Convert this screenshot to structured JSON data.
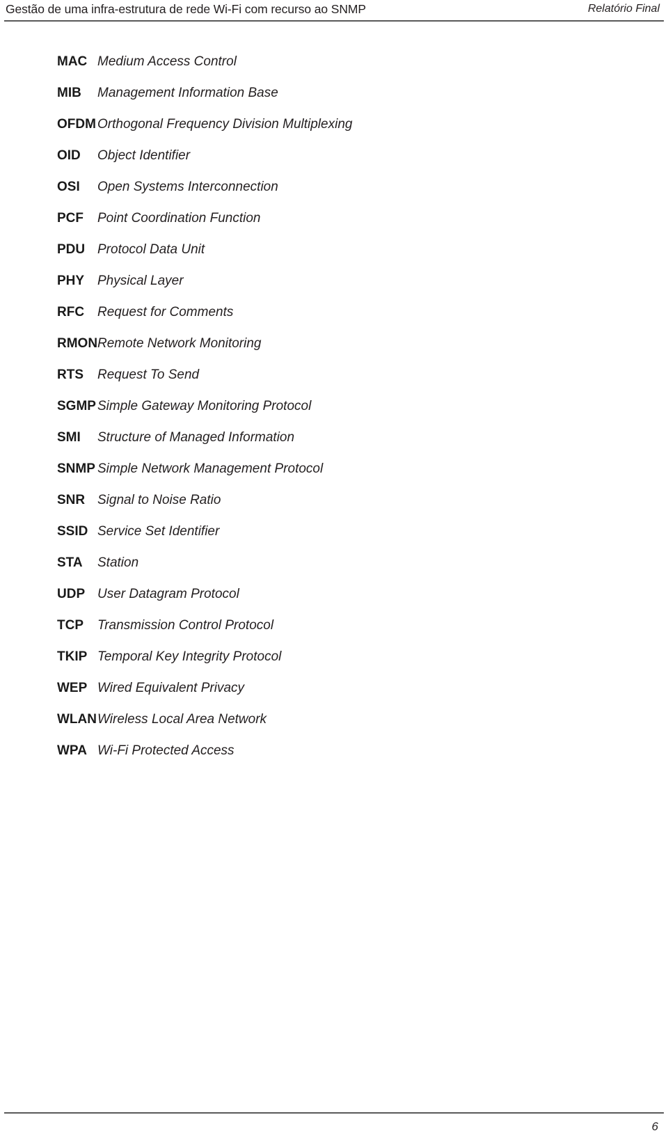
{
  "header": {
    "title": "Gestão de uma infra-estrutura de rede Wi-Fi com recurso ao SNMP",
    "right_label": "Relatório Final"
  },
  "glossary": {
    "entries": [
      {
        "abbr": "MAC",
        "definition": "Medium Access Control"
      },
      {
        "abbr": "MIB",
        "definition": "Management Information Base"
      },
      {
        "abbr": "OFDM",
        "definition": "Orthogonal Frequency Division Multiplexing"
      },
      {
        "abbr": "OID",
        "definition": "Object Identifier"
      },
      {
        "abbr": "OSI",
        "definition": "Open Systems Interconnection"
      },
      {
        "abbr": "PCF",
        "definition": "Point Coordination Function"
      },
      {
        "abbr": "PDU",
        "definition": "Protocol Data Unit"
      },
      {
        "abbr": "PHY",
        "definition": "Physical Layer"
      },
      {
        "abbr": "RFC",
        "definition": "Request for Comments"
      },
      {
        "abbr": "RMON",
        "definition": "Remote Network Monitoring"
      },
      {
        "abbr": "RTS",
        "definition": "Request To Send"
      },
      {
        "abbr": "SGMP",
        "definition": "Simple Gateway Monitoring Protocol"
      },
      {
        "abbr": "SMI",
        "definition": "Structure of Managed Information"
      },
      {
        "abbr": "SNMP",
        "definition": "Simple Network Management Protocol"
      },
      {
        "abbr": "SNR",
        "definition": "Signal to Noise Ratio"
      },
      {
        "abbr": "SSID",
        "definition": "Service Set Identifier"
      },
      {
        "abbr": "STA",
        "definition": "Station"
      },
      {
        "abbr": "UDP",
        "definition": "User Datagram Protocol"
      },
      {
        "abbr": "TCP",
        "definition": "Transmission Control Protocol"
      },
      {
        "abbr": "TKIP",
        "definition": "Temporal Key Integrity Protocol"
      },
      {
        "abbr": "WEP",
        "definition": "Wired Equivalent Privacy"
      },
      {
        "abbr": "WLAN",
        "definition": "Wireless Local Area Network"
      },
      {
        "abbr": "WPA",
        "definition": "Wi-Fi Protected Access"
      }
    ]
  },
  "footer": {
    "page_number": "6"
  }
}
